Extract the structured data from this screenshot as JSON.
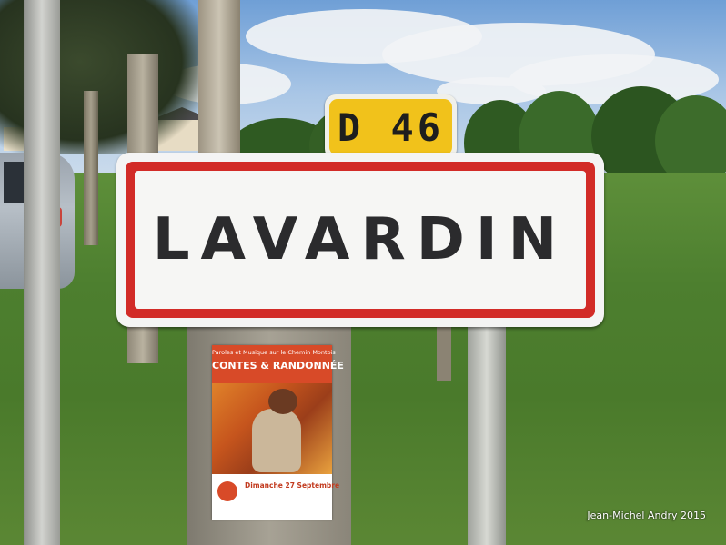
{
  "sign": {
    "route_label": "D 46",
    "town_name": "LAVARDIN"
  },
  "poster": {
    "line1": "Paroles et Musique sur le Chemin Montois",
    "line2": "CONTES & RANDONNÉE",
    "date": "Dimanche 27 Septembre"
  },
  "credit": "Jean-Michel Andry 2015",
  "colors": {
    "sign_border": "#d22b27",
    "route_plate": "#f1c21b",
    "grass": "#4d7f2f",
    "sky": "#8fb6e0"
  }
}
